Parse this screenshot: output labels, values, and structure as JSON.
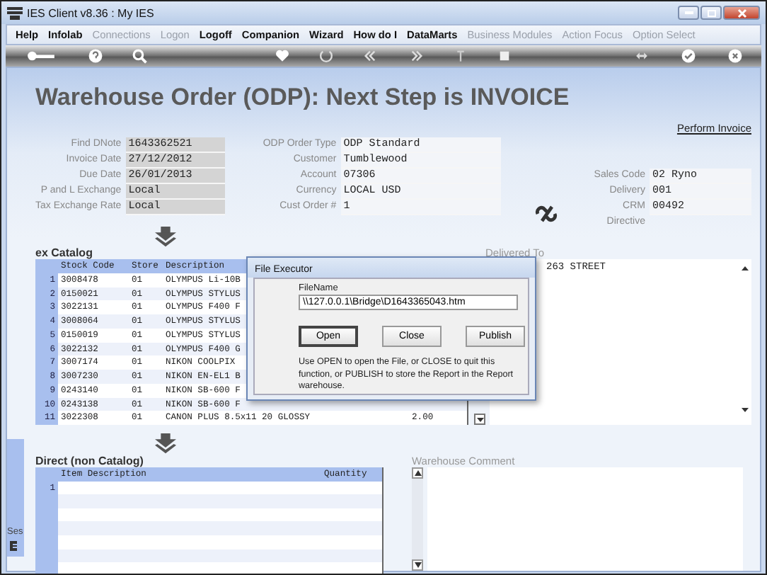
{
  "window": {
    "title": "IES Client v8.36 : My IES"
  },
  "menu": [
    {
      "label": "Help",
      "disabled": false
    },
    {
      "label": "Infolab",
      "disabled": false
    },
    {
      "label": "Connections",
      "disabled": true
    },
    {
      "label": "Logon",
      "disabled": true
    },
    {
      "label": "Logoff",
      "disabled": false
    },
    {
      "label": "Companion",
      "disabled": false
    },
    {
      "label": "Wizard",
      "disabled": false
    },
    {
      "label": "How do I",
      "disabled": false
    },
    {
      "label": "DataMarts",
      "disabled": false
    },
    {
      "label": "Business Modules",
      "disabled": true
    },
    {
      "label": "Action Focus",
      "disabled": true
    },
    {
      "label": "Option Select",
      "disabled": true
    }
  ],
  "heading": "Warehouse Order (ODP): Next Step is INVOICE",
  "perform_link": "Perform Invoice",
  "fields_left": [
    {
      "label": "Find DNote",
      "value": "1643362521"
    },
    {
      "label": "Invoice Date",
      "value": "27/12/2012"
    },
    {
      "label": "Due Date",
      "value": "26/01/2013"
    },
    {
      "label": "P and L Exchange",
      "value": "Local"
    },
    {
      "label": "Tax Exchange Rate",
      "value": "Local"
    }
  ],
  "fields_middle": [
    {
      "label": "ODP Order Type",
      "value": "ODP Standard"
    },
    {
      "label": "Customer",
      "value": "Tumblewood"
    },
    {
      "label": "Account",
      "value": "07306"
    },
    {
      "label": "Currency",
      "value": "LOCAL USD"
    },
    {
      "label": "Cust Order #",
      "value": "1"
    }
  ],
  "fields_right": [
    {
      "label": "Sales Code",
      "value": "02 Ryno"
    },
    {
      "label": "Delivery",
      "value": "001"
    },
    {
      "label": "CRM",
      "value": "00492"
    },
    {
      "label": "Directive"
    }
  ],
  "catalog": {
    "title": "ex Catalog",
    "columns": [
      "Stock Code",
      "Store",
      "Description"
    ],
    "rows": [
      {
        "number": "1",
        "stock_code": "3008478",
        "store": "01",
        "description": "OLYMPUS Li-10B"
      },
      {
        "number": "2",
        "stock_code": "0150021",
        "store": "01",
        "description": "OLYMPUS STYLUS"
      },
      {
        "number": "3",
        "stock_code": "3022131",
        "store": "01",
        "description": "OLYMPUS F400 F"
      },
      {
        "number": "4",
        "stock_code": "3008064",
        "store": "01",
        "description": "OLYMPUS STYLUS"
      },
      {
        "number": "5",
        "stock_code": "0150019",
        "store": "01",
        "description": "OLYMPUS STYLUS"
      },
      {
        "number": "6",
        "stock_code": "3022132",
        "store": "01",
        "description": "OLYMPUS F400 G"
      },
      {
        "number": "7",
        "stock_code": "3007174",
        "store": "01",
        "description": "NIKON COOLPIX"
      },
      {
        "number": "8",
        "stock_code": "3007230",
        "store": "01",
        "description": "NIKON EN-EL1 B"
      },
      {
        "number": "9",
        "stock_code": "0243140",
        "store": "01",
        "description": "NIKON SB-600 F"
      },
      {
        "number": "10",
        "stock_code": "0243138",
        "store": "01",
        "description": "NIKON SB-600 F"
      },
      {
        "number": "11",
        "stock_code": "3022308",
        "store": "01",
        "description": "CANON PLUS 8.5x11 20 GLOSSY",
        "quantity": "2.00"
      }
    ]
  },
  "delivered_to": {
    "label": "Delivered To",
    "text": "263 STREET"
  },
  "direct": {
    "title": "Direct (non Catalog)",
    "columns": [
      "Item Description",
      "Quantity"
    ],
    "rows": [
      {
        "number": "1"
      }
    ]
  },
  "warehouse_comment": {
    "label": "Warehouse Comment"
  },
  "side_panel": {
    "text": "Ses"
  },
  "dialog": {
    "title": "File Executor",
    "field_label": "FileName",
    "file_name": "\\\\127.0.0.1\\Bridge\\D1643365043.htm",
    "buttons": [
      {
        "label": "Open",
        "selected": true
      },
      {
        "label": "Close",
        "selected": false
      },
      {
        "label": "Publish",
        "selected": false
      }
    ],
    "message": "Use OPEN to open the File, or CLOSE to quit this function, or PUBLISH to store the Report in the Report warehouse."
  }
}
